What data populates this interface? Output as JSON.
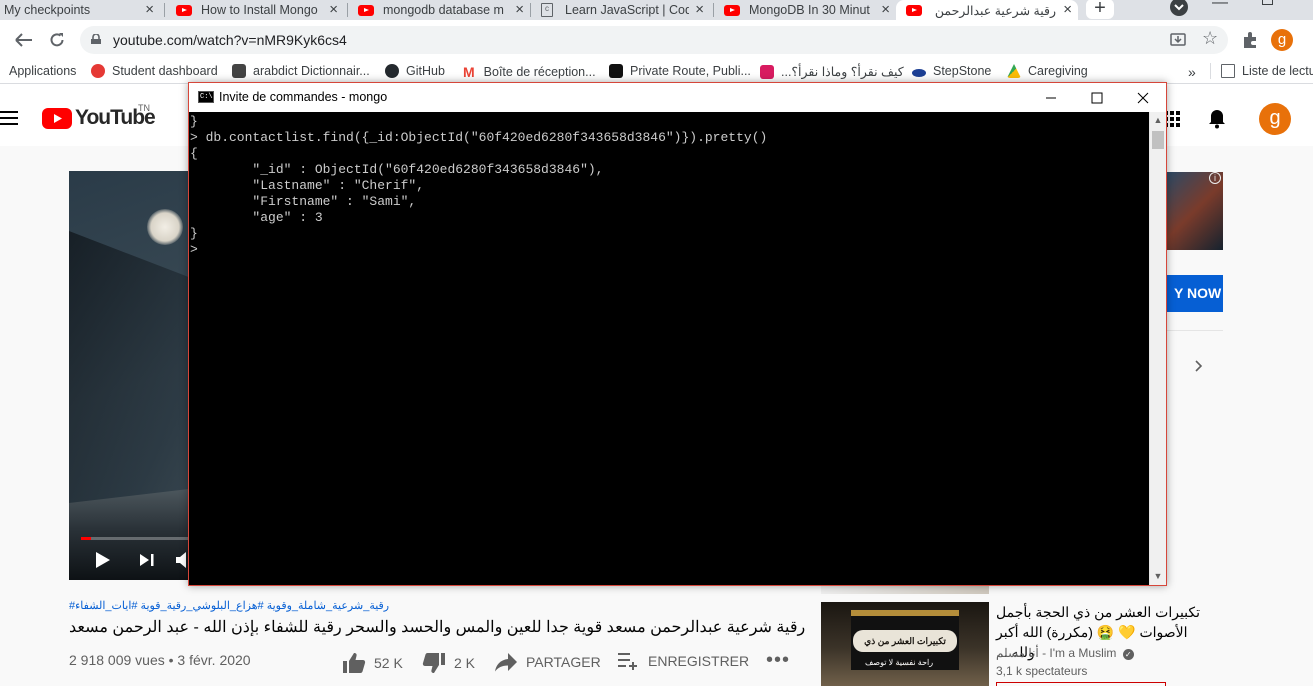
{
  "browser": {
    "tabs": [
      {
        "title": "My checkpoints",
        "icon": "doc-icon"
      },
      {
        "title": "How to Install Mongo",
        "icon": "youtube-icon"
      },
      {
        "title": "mongodb database m",
        "icon": "youtube-icon"
      },
      {
        "title": "Learn JavaScript | Cod",
        "icon": "doc-icon"
      },
      {
        "title": "MongoDB In 30 Minut",
        "icon": "youtube-icon"
      },
      {
        "title": "رقية شرعية عبدالرحمن م",
        "icon": "youtube-icon"
      }
    ],
    "url": "youtube.com/watch?v=nMR9Kyk6cs4",
    "profile_initial": "g",
    "bookmarks": [
      "Applications",
      "Student dashboard",
      "arabdict Dictionnair...",
      "GitHub",
      "Boîte de réception...",
      "Private Route, Publi...",
      "كيف نقرأ؟ وماذا نقرأ؟...",
      "StepStone",
      "Caregiving"
    ],
    "reading_list": "Liste de lectu"
  },
  "youtube": {
    "logo_text": "YouTube",
    "logo_region": "TN",
    "avatar_initial": "g",
    "ad_button": "Y NOW",
    "hashtags": "#رقية_شرعية_شاملة_وقوية #هزاع_البلوشي_رقية_قوية #ايات_الشفاء",
    "video_title": "رقية شرعية عبدالرحمن مسعد قوية جدا للعين والمس والحسد والسحر رقية للشفاء بإذن الله - عبد الرحمن مسعد",
    "views": "2 918 009 vues • 3 févr. 2020",
    "likes": "52 K",
    "dislikes": "2 K",
    "share": "PARTAGER",
    "save": "ENREGISTRER",
    "recommendation": {
      "title": "تكبيرات العشر من ذي الحجة بأجمل الأصوات 💛 🤮 (مكررة) الله أكبر ولله ...",
      "channel": "أنا مسلم - I'm a Muslim",
      "viewers": "3,1 k spectateurs",
      "thumb_banner": "تكبيرات العشر من ذي الحجة",
      "thumb_sub": "راحة نفسية لا توصف"
    }
  },
  "console": {
    "window_title": "Invite de commandes - mongo",
    "lines": [
      "}",
      "> db.contactlist.find({_id:ObjectId(\"60f420ed6280f343658d3846\")}).pretty()",
      "{",
      "        \"_id\" : ObjectId(\"60f420ed6280f343658d3846\"),",
      "        \"Lastname\" : \"Cherif\",",
      "        \"Firstname\" : \"Sami\",",
      "        \"age\" : 3",
      "}",
      ">"
    ]
  }
}
